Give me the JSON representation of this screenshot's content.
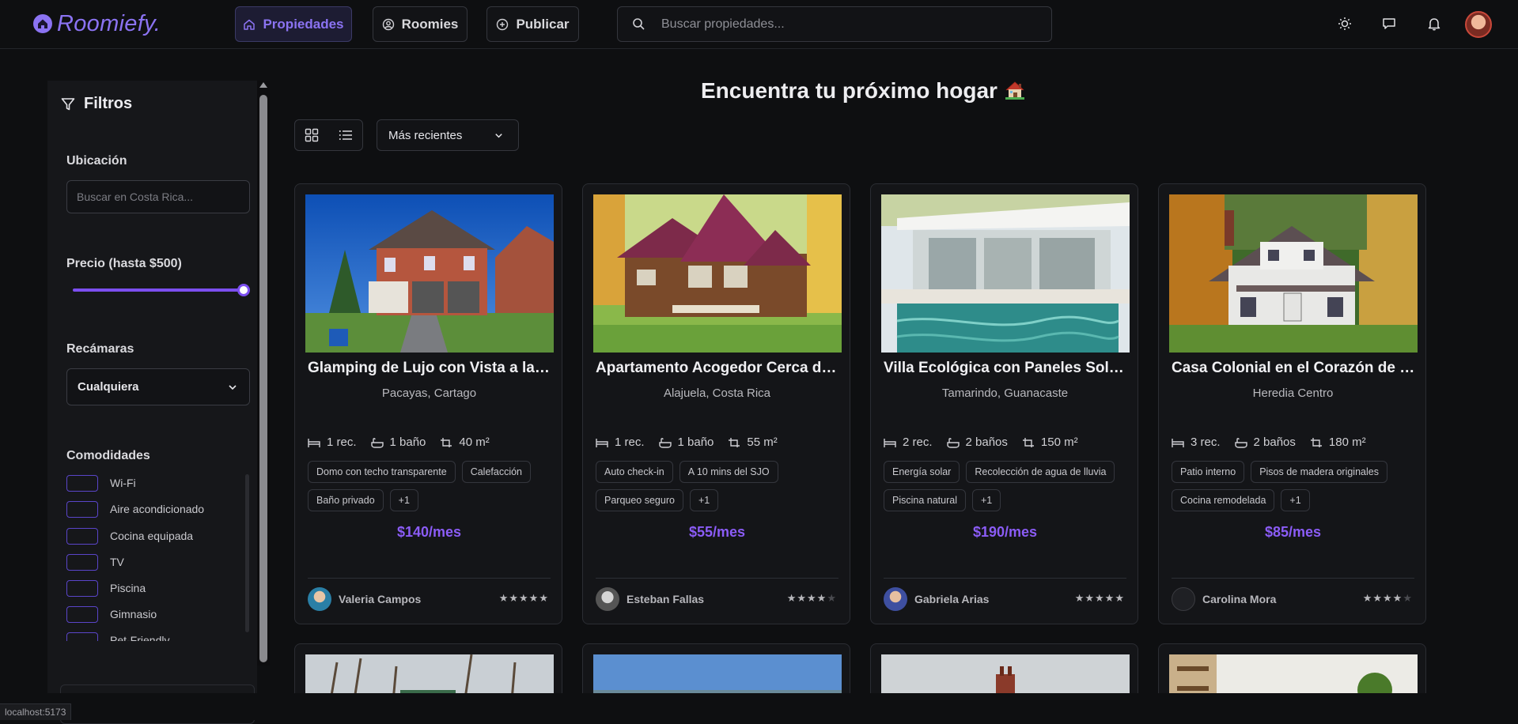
{
  "app": {
    "name": "Roomiefy."
  },
  "nav": [
    {
      "label": "Propiedades",
      "icon": "home-icon",
      "active": true
    },
    {
      "label": "Roomies",
      "icon": "user-circle-icon",
      "active": false
    },
    {
      "label": "Publicar",
      "icon": "plus-circle-icon",
      "active": false
    }
  ],
  "search": {
    "placeholder": "Buscar propiedades..."
  },
  "header_icons": [
    "sun-icon",
    "chat-icon",
    "bell-icon",
    "avatar"
  ],
  "filters": {
    "title": "Filtros",
    "location_label": "Ubicación",
    "location_placeholder": "Buscar en Costa Rica...",
    "price_label": "Precio (hasta $500)",
    "price_value_fraction": 1.0,
    "bedrooms_label": "Recámaras",
    "bedrooms_value": "Cualquiera",
    "amenities_label": "Comodidades",
    "amenities": [
      "Wi-Fi",
      "Aire acondicionado",
      "Cocina equipada",
      "TV",
      "Piscina",
      "Gimnasio",
      "Pet-Friendly"
    ]
  },
  "main": {
    "title": "Encuentra tu próximo hogar",
    "sort_value": "Más recientes"
  },
  "properties": [
    {
      "title": "Glamping de Lujo con Vista a las…",
      "location": "Pacayas, Cartago",
      "bedrooms": "1 rec.",
      "baths": "1 baño",
      "area": "40 m²",
      "tags": [
        "Domo con techo transparente",
        "Calefacción",
        "Baño privado",
        "+1"
      ],
      "price": "$140/mes",
      "owner": "Valeria Campos",
      "rating": 5
    },
    {
      "title": "Apartamento Acogedor Cerca d…",
      "location": "Alajuela, Costa Rica",
      "bedrooms": "1 rec.",
      "baths": "1 baño",
      "area": "55 m²",
      "tags": [
        "Auto check-in",
        "A 10 mins del SJO",
        "Parqueo seguro",
        "+1"
      ],
      "price": "$55/mes",
      "owner": "Esteban Fallas",
      "rating": 4
    },
    {
      "title": "Villa Ecológica con Paneles Solar…",
      "location": "Tamarindo, Guanacaste",
      "bedrooms": "2 rec.",
      "baths": "2 baños",
      "area": "150 m²",
      "tags": [
        "Energía solar",
        "Recolección de agua de lluvia",
        "Piscina natural",
        "+1"
      ],
      "price": "$190/mes",
      "owner": "Gabriela Arias",
      "rating": 5
    },
    {
      "title": "Casa Colonial en el Corazón de …",
      "location": "Heredia Centro",
      "bedrooms": "3 rec.",
      "baths": "2 baños",
      "area": "180 m²",
      "tags": [
        "Patio interno",
        "Pisos de madera originales",
        "Cocina remodelada",
        "+1"
      ],
      "price": "$85/mes",
      "owner": "Carolina Mora",
      "rating": 4
    }
  ],
  "status_bar": {
    "url": "localhost:5173"
  },
  "colors": {
    "accent": "#8b5cf6",
    "background": "#0e0f11",
    "card": "#141518"
  }
}
